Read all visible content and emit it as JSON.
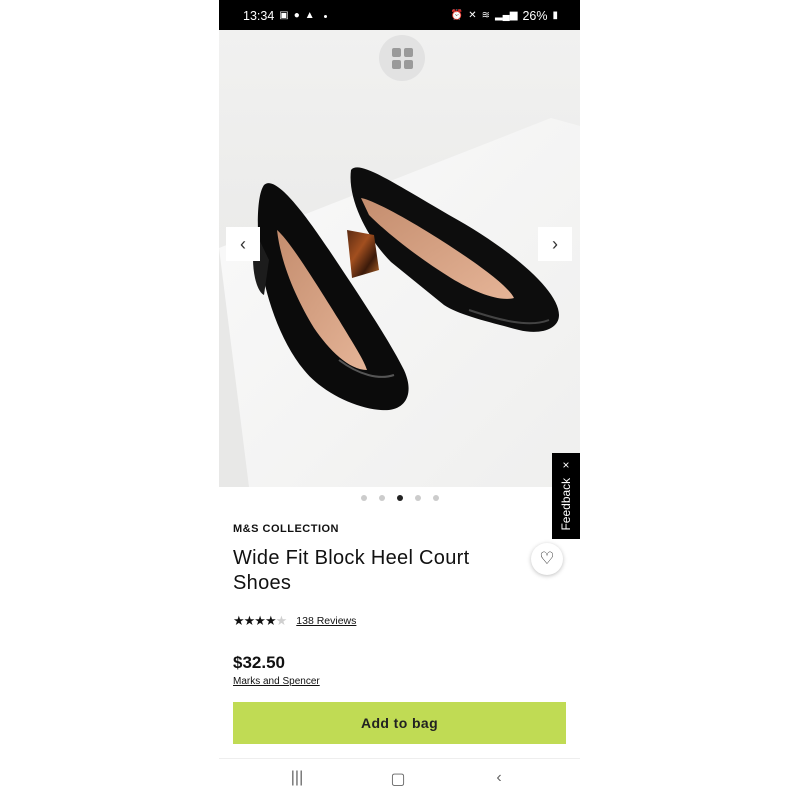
{
  "status_bar": {
    "time": "13:34",
    "battery": "26%",
    "icons_left": [
      "gallery-icon",
      "messenger-icon",
      "alert-icon"
    ],
    "icons_right": [
      "alarm-icon",
      "mute-icon",
      "wifi-icon",
      "signal-icon",
      "signal-icon",
      "battery-icon"
    ]
  },
  "gallery": {
    "image_count": 5,
    "active_index": 2,
    "product_image": "black patent block heel court shoes with tortoiseshell heels"
  },
  "feedback": {
    "label": "Feedback",
    "close": "×"
  },
  "product": {
    "brand": "M&S COLLECTION",
    "title": "Wide Fit Block Heel Court Shoes",
    "rating": 4.5,
    "reviews_label": "138 Reviews",
    "price": "$32.50",
    "seller": "Marks and Spencer"
  },
  "actions": {
    "add_to_bag": "Add to bag"
  },
  "colors": {
    "accent": "#c0db54",
    "status_bar": "#000000",
    "feedback_tab": "#000000"
  }
}
